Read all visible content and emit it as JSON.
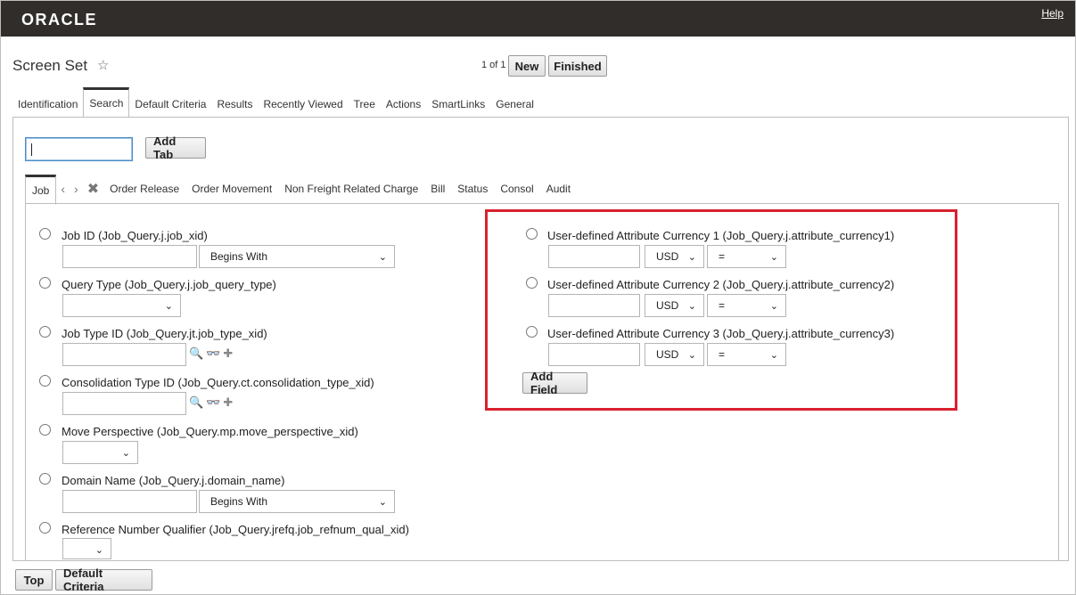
{
  "header": {
    "logo": "ORACLE",
    "help": "Help"
  },
  "title": "Screen Set",
  "pager": "1 of 1",
  "buttons": {
    "new": "New",
    "finished": "Finished",
    "add_tab": "Add Tab",
    "add_field": "Add Field",
    "top": "Top",
    "default_criteria": "Default Criteria"
  },
  "tabs": [
    "Identification",
    "Search",
    "Default Criteria",
    "Results",
    "Recently Viewed",
    "Tree",
    "Actions",
    "SmartLinks",
    "General"
  ],
  "inner_tabs": {
    "active": "Job",
    "prev": "‹",
    "next": "›",
    "delete": "✖",
    "items": [
      "Order Release",
      "Order Movement",
      "Non Freight Related Charge",
      "Bill",
      "Status",
      "Consol",
      "Audit"
    ]
  },
  "left_fields": [
    {
      "label": "Job ID (Job_Query.j.job_xid)",
      "operator": "Begins With"
    },
    {
      "label": "Query Type (Job_Query.j.job_query_type)"
    },
    {
      "label": "Job Type ID (Job_Query.jt.job_type_xid)"
    },
    {
      "label": "Consolidation Type ID (Job_Query.ct.consolidation_type_xid)"
    },
    {
      "label": "Move Perspective (Job_Query.mp.move_perspective_xid)"
    },
    {
      "label": "Domain Name (Job_Query.j.domain_name)",
      "operator": "Begins With"
    },
    {
      "label": "Reference Number Qualifier (Job_Query.jrefq.job_refnum_qual_xid)"
    }
  ],
  "right_fields": [
    {
      "label": "User-defined Attribute Currency 1 (Job_Query.j.attribute_currency1)",
      "currency": "USD",
      "operator": "="
    },
    {
      "label": "User-defined Attribute Currency 2 (Job_Query.j.attribute_currency2)",
      "currency": "USD",
      "operator": "="
    },
    {
      "label": "User-defined Attribute Currency 3 (Job_Query.j.attribute_currency3)",
      "currency": "USD",
      "operator": "="
    }
  ],
  "icons": {
    "chevron": "⌄",
    "search": "🔍",
    "glasses": "👓",
    "plus": "✚",
    "star": "☆"
  },
  "colors": {
    "header_bg": "#312d2a",
    "highlight": "#d9212f",
    "focus": "#4a8cc4"
  }
}
